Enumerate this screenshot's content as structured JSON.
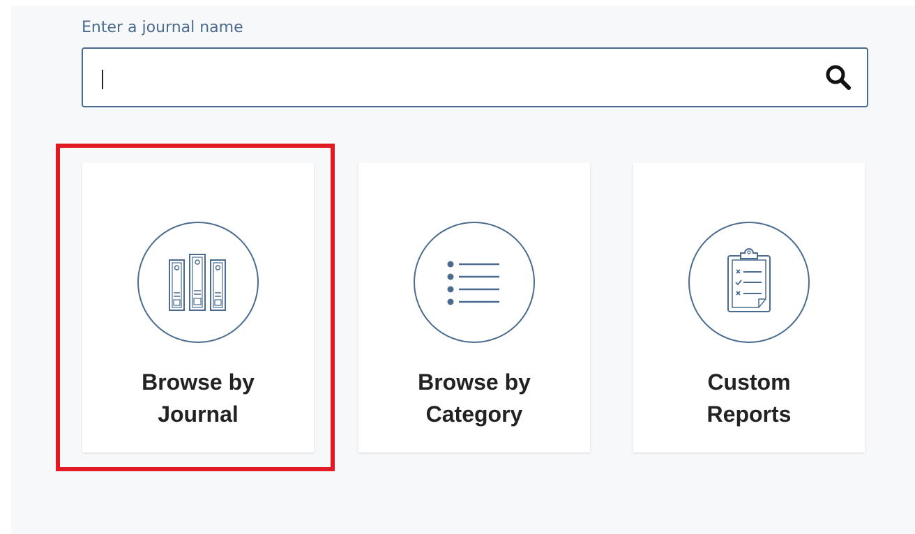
{
  "search": {
    "label": "Enter a journal name",
    "value": "",
    "placeholder": ""
  },
  "cards": [
    {
      "line1": "Browse by",
      "line2": "Journal",
      "icon": "binders-icon"
    },
    {
      "line1": "Browse by",
      "line2": "Category",
      "icon": "list-icon"
    },
    {
      "line1": "Custom",
      "line2": "Reports",
      "icon": "clipboard-checklist-icon"
    }
  ],
  "colors": {
    "accent": "#4a6b8f",
    "highlight": "#e21a23",
    "background": "#f7f8fa"
  }
}
